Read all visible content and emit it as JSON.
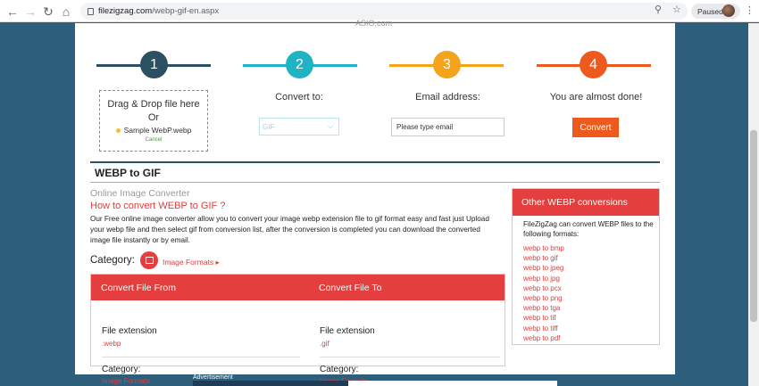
{
  "browser": {
    "url_domain": "filezigzag.com",
    "url_path": "/webp-gif-en.aspx",
    "paused_label": "Paused"
  },
  "site": {
    "top_text": "ASIO.com"
  },
  "steps": [
    {
      "number": "1",
      "color": "#2b4f63"
    },
    {
      "number": "2",
      "color": "#1fb3c4"
    },
    {
      "number": "3",
      "color": "#f4a31b"
    },
    {
      "number": "4",
      "color": "#ee5a1e"
    }
  ],
  "upload": {
    "title": "Drag & Drop file here",
    "or": "Or",
    "file_name": "Sample WebP.webp",
    "cancel": "Cancel"
  },
  "convert_to": {
    "label": "Convert to:",
    "selected": "GIF"
  },
  "email": {
    "label": "Email address:",
    "value": "Please type email"
  },
  "finish": {
    "label": "You are almost done!",
    "button": "Convert"
  },
  "section": {
    "title": "WEBP to GIF",
    "subtitle": "Online Image Converter",
    "heading": "How to convert WEBP to GIF ?",
    "description": "Our Free online image converter allow you to convert your image webp extension file to gif format easy and fast just Upload your webp file and then select gif from conversion list, after the conversion is completed you can download the converted image file instantly or by email.",
    "category_label": "Category:",
    "category_link": "Image Formats"
  },
  "table": {
    "from": {
      "header": "Convert File From",
      "ext_label": "File extension",
      "ext_value": ".webp",
      "cat_label": "Category:",
      "cat_value": "Image Formats"
    },
    "to": {
      "header": "Convert File To",
      "ext_label": "File extension",
      "ext_value": ".gif",
      "cat_label": "Category:",
      "cat_value": "Image Formats"
    }
  },
  "sidebar": {
    "title": "Other WEBP conversions",
    "intro": "FileZigZag can convert WEBP files to the following formats:",
    "links": [
      "webp to bmp",
      "webp to gif",
      "webp to jpeg",
      "webp to jpg",
      "webp to pcx",
      "webp to png",
      "webp to tga",
      "webp to tif",
      "webp to tiff",
      "webp to pdf"
    ]
  },
  "ad": {
    "label": "Advertisement"
  }
}
